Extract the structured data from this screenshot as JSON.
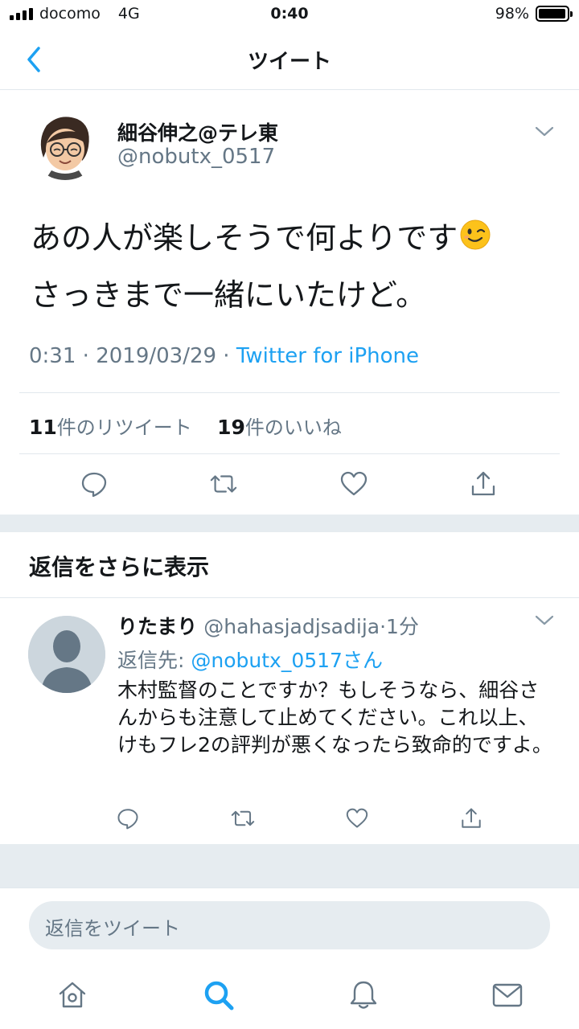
{
  "status_bar": {
    "carrier": "docomo",
    "network": "4G",
    "time": "0:40",
    "battery": "98%",
    "battery_level": 0.98
  },
  "nav": {
    "back_icon": "chevron-left-icon",
    "title": "ツイート"
  },
  "tweet": {
    "author_name": "細谷伸之@テレ東",
    "author_handle": "@nobutx_0517",
    "text_line1": "あの人が楽しそうで何よりです",
    "text_line2": "さっきまで一緒にいたけど。",
    "time": "0:31",
    "sep1": " · ",
    "date": "2019/03/29",
    "sep2": " · ",
    "source": "Twitter for iPhone",
    "retweet_count": "11",
    "retweet_label": "件のリツイート",
    "like_count": "19",
    "like_label": "件のいいね"
  },
  "more_replies": {
    "label": "返信をさらに表示"
  },
  "reply": {
    "name": "りたまり",
    "handle": "@hahasjadjsadija",
    "time": "·1分",
    "reply_to_label": "返信先: ",
    "reply_to_link": "@nobutx_0517さん",
    "body": "木村監督のことですか？もしそうなら、細谷さんからも注意して止めてください。これ以上、けもフレ2の評判が悪くなったら致命的ですよ。"
  },
  "compose": {
    "placeholder": "返信をツイート"
  },
  "colors": {
    "accent": "#1da1f2",
    "muted_text": "#657786",
    "divider": "#e1e8ed",
    "section_gap": "#e6ecf0"
  },
  "tab_icons": [
    "home-icon",
    "search-icon",
    "notifications-icon",
    "messages-icon"
  ]
}
